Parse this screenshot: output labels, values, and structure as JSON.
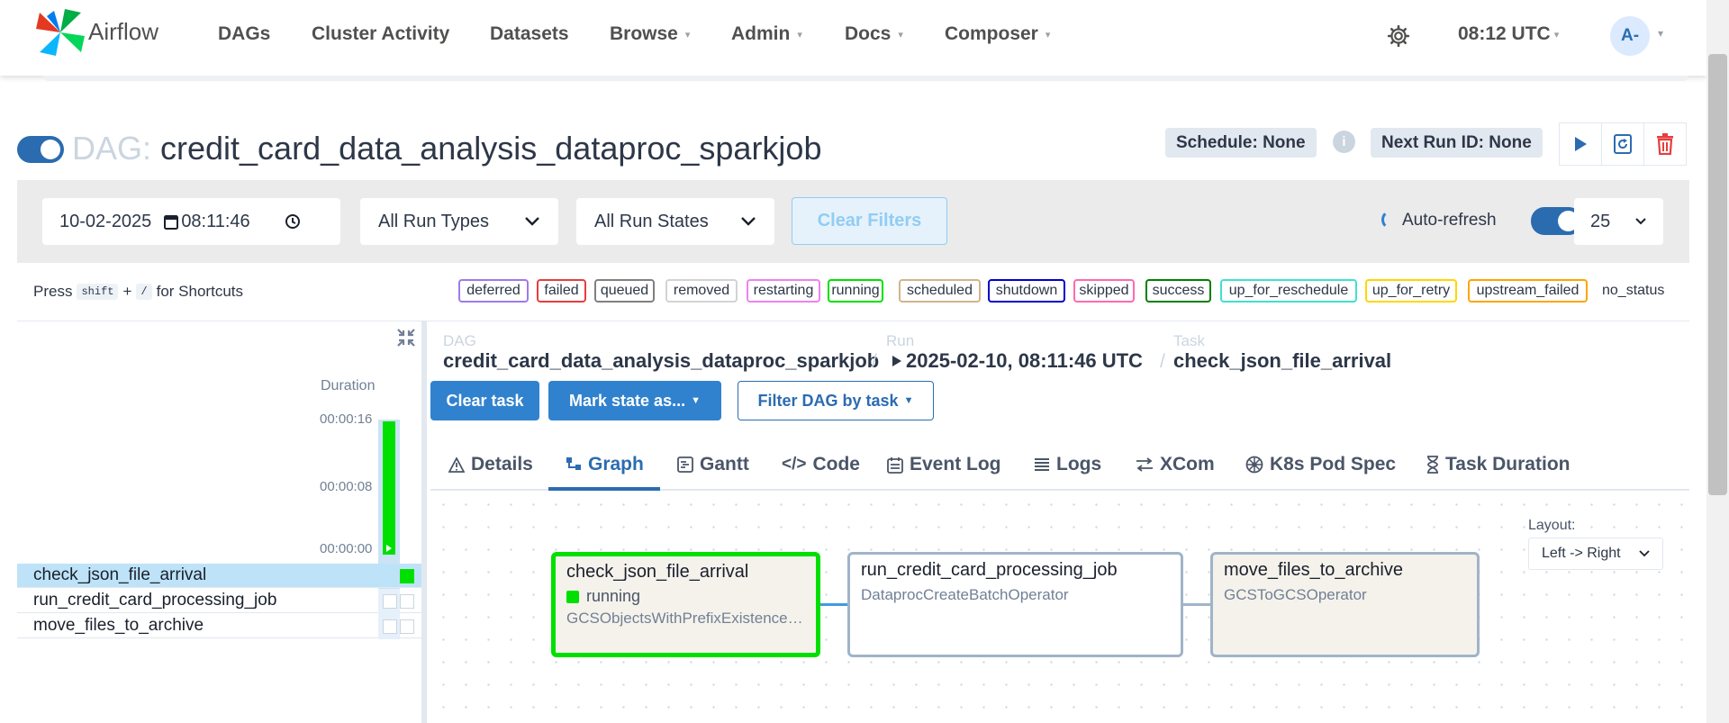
{
  "nav": {
    "brand": "Airflow",
    "items": [
      "DAGs",
      "Cluster Activity",
      "Datasets",
      "Browse",
      "Admin",
      "Docs",
      "Composer"
    ],
    "time": "08:12 UTC",
    "avatar": "A-"
  },
  "dag": {
    "label": "DAG:",
    "id": "credit_card_data_analysis_dataproc_sparkjob",
    "schedule": "Schedule: None",
    "next_run": "Next Run ID: None"
  },
  "filters": {
    "date": "10-02-2025",
    "time": "08:11:46",
    "run_types": "All Run Types",
    "run_states": "All Run States",
    "clear": "Clear Filters",
    "auto_refresh": "Auto-refresh",
    "page_size": "25"
  },
  "shortcuts": {
    "press": "Press",
    "key1": "shift",
    "plus": "+",
    "key2": "/",
    "suffix": "for Shortcuts"
  },
  "legend": [
    {
      "label": "deferred",
      "color": "#9f7aea"
    },
    {
      "label": "failed",
      "color": "#e53e3e"
    },
    {
      "label": "queued",
      "color": "#808080"
    },
    {
      "label": "removed",
      "color": "#d3d3d3"
    },
    {
      "label": "restarting",
      "color": "#ee82ee"
    },
    {
      "label": "running",
      "color": "#00e000"
    },
    {
      "label": "scheduled",
      "color": "#d2b48c"
    },
    {
      "label": "shutdown",
      "color": "#0000cd"
    },
    {
      "label": "skipped",
      "color": "#ff69b4"
    },
    {
      "label": "success",
      "color": "#008000"
    },
    {
      "label": "up_for_reschedule",
      "color": "#40e0d0"
    },
    {
      "label": "up_for_retry",
      "color": "#ffd700"
    },
    {
      "label": "upstream_failed",
      "color": "#ffa500"
    },
    {
      "label": "no_status",
      "color": ""
    }
  ],
  "grid": {
    "duration_label": "Duration",
    "ticks": [
      "00:00:16",
      "00:00:08",
      "00:00:00"
    ],
    "tasks": [
      "check_json_file_arrival",
      "run_credit_card_processing_job",
      "move_files_to_archive"
    ]
  },
  "breadcrumb": {
    "dag_label": "DAG",
    "dag": "credit_card_data_analysis_dataproc_sparkjob",
    "run_label": "Run",
    "run": "2025-02-10, 08:11:46 UTC",
    "task_label": "Task",
    "task": "check_json_file_arrival"
  },
  "actions": {
    "clear_task": "Clear task",
    "mark_state": "Mark state as...",
    "filter_dag": "Filter DAG by task"
  },
  "tabs": [
    "Details",
    "Graph",
    "Gantt",
    "Code",
    "Event Log",
    "Logs",
    "XCom",
    "K8s Pod Spec",
    "Task Duration"
  ],
  "graph": {
    "layout_label": "Layout:",
    "layout_value": "Left -> Right",
    "nodes": [
      {
        "name": "check_json_file_arrival",
        "state": "running",
        "operator": "GCSObjectsWithPrefixExistenceSensor"
      },
      {
        "name": "run_credit_card_processing_job",
        "operator": "DataprocCreateBatchOperator"
      },
      {
        "name": "move_files_to_archive",
        "operator": "GCSToGCSOperator"
      }
    ]
  }
}
